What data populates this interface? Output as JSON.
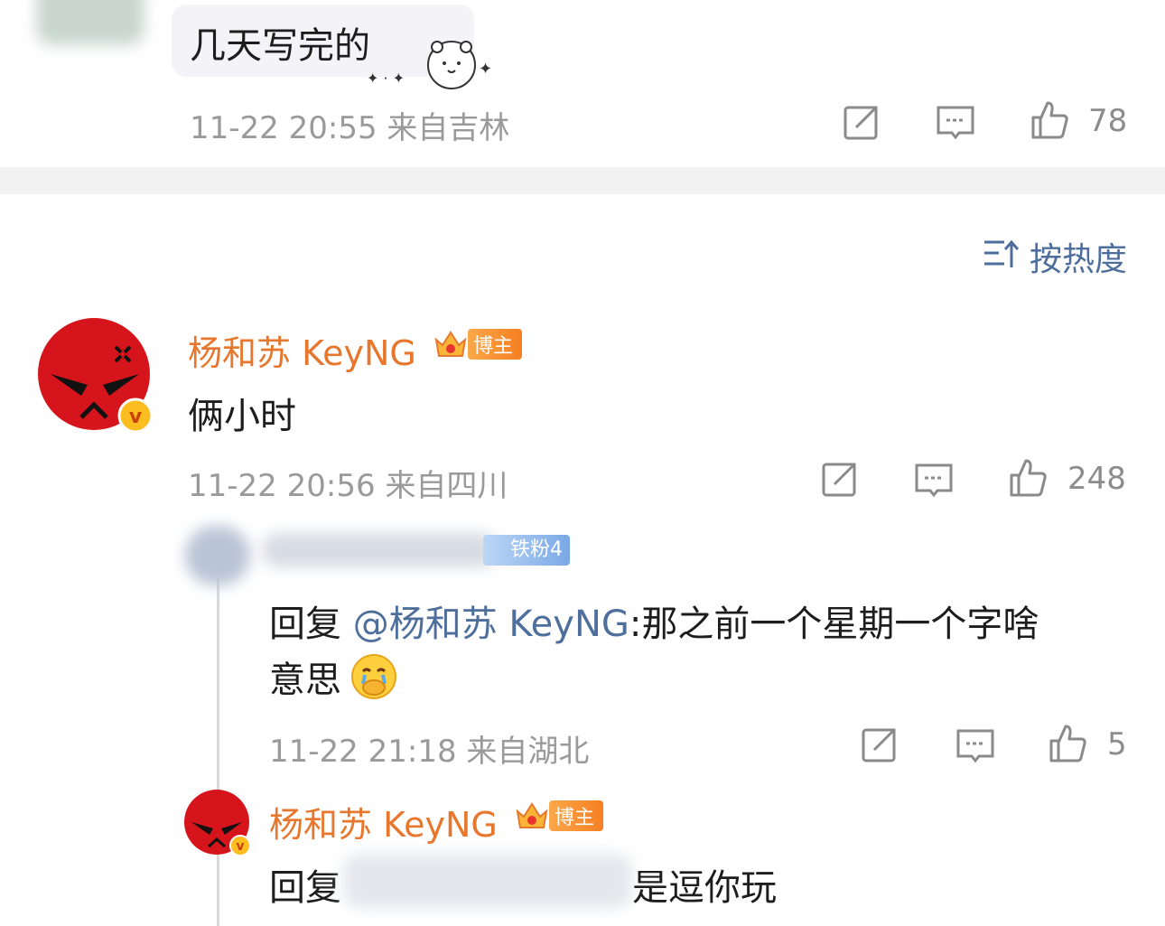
{
  "comment_top": {
    "text": "几天写完的",
    "meta": "11-22 20:55 来自吉林",
    "likes": "78"
  },
  "sort": {
    "label": "按热度"
  },
  "comment_main": {
    "author": "杨和苏 KeyNG",
    "badge": "博主",
    "text": "俩小时",
    "meta": "11-22 20:56 来自四川",
    "likes": "248"
  },
  "reply1": {
    "fan_badge": "铁粉4",
    "prefix": "回复 ",
    "mention": "@杨和苏 KeyNG",
    "text_line1": ":那之前一个星期一个字啥",
    "text_line2": "意思",
    "meta": "11-22 21:18 来自湖北",
    "likes": "5"
  },
  "reply2": {
    "author": "杨和苏 KeyNG",
    "badge": "博主",
    "prefix": "回复",
    "text_tail": "是逗你玩"
  },
  "colors": {
    "name": "#e8772e",
    "mention": "#4e6f9b",
    "meta": "#9a9a9a",
    "avatar_red": "#d5141b"
  }
}
